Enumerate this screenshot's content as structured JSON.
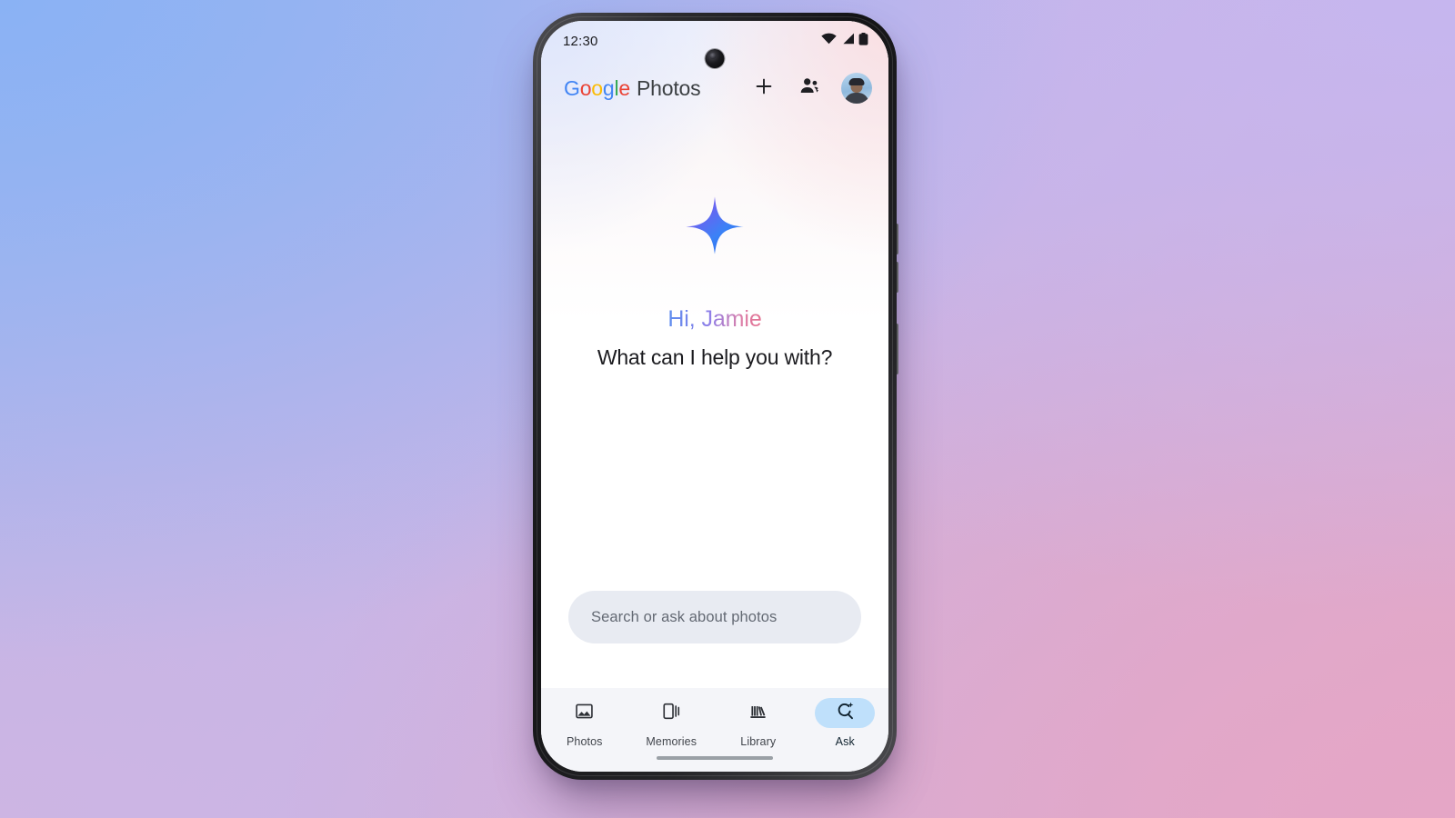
{
  "theme": {
    "backdrop_top_left": "#8ab2f4",
    "backdrop_top_right": "#c6b6ef",
    "backdrop_bottom_right": "#e5a6c6",
    "backdrop_bottom_left": "#cdb5e3",
    "accent_pill": "#bfe0fb",
    "search_field_bg": "#e8ebf2",
    "nav_bar_bg": "#f4f5f9"
  },
  "status_bar": {
    "time": "12:30",
    "icons": [
      "wifi-icon",
      "cellular-signal-icon",
      "battery-icon"
    ]
  },
  "app_bar": {
    "brand_google": "Google",
    "brand_google_letters": [
      "G",
      "o",
      "o",
      "g",
      "l",
      "e"
    ],
    "brand_product": "Photos",
    "actions": [
      {
        "name": "add-button",
        "icon": "plus-icon"
      },
      {
        "name": "sharing-button",
        "icon": "people-icon"
      },
      {
        "name": "account-avatar",
        "icon": "avatar"
      }
    ]
  },
  "hero": {
    "sparkle_icon": "gemini-sparkle-icon",
    "greeting": "Hi, Jamie",
    "question": "What can I help you with?",
    "greeting_gradient_from": "#5b8def",
    "greeting_gradient_to": "#e36f8e"
  },
  "search": {
    "placeholder": "Search or ask about photos",
    "value": ""
  },
  "bottom_nav": {
    "items": [
      {
        "label": "Photos",
        "icon": "photo-image-icon",
        "active": false
      },
      {
        "label": "Memories",
        "icon": "memories-cards-icon",
        "active": false
      },
      {
        "label": "Library",
        "icon": "library-shelf-icon",
        "active": false
      },
      {
        "label": "Ask",
        "icon": "ask-search-sparkle-icon",
        "active": true
      }
    ]
  },
  "system": {
    "home_indicator": "home-gesture-bar"
  }
}
